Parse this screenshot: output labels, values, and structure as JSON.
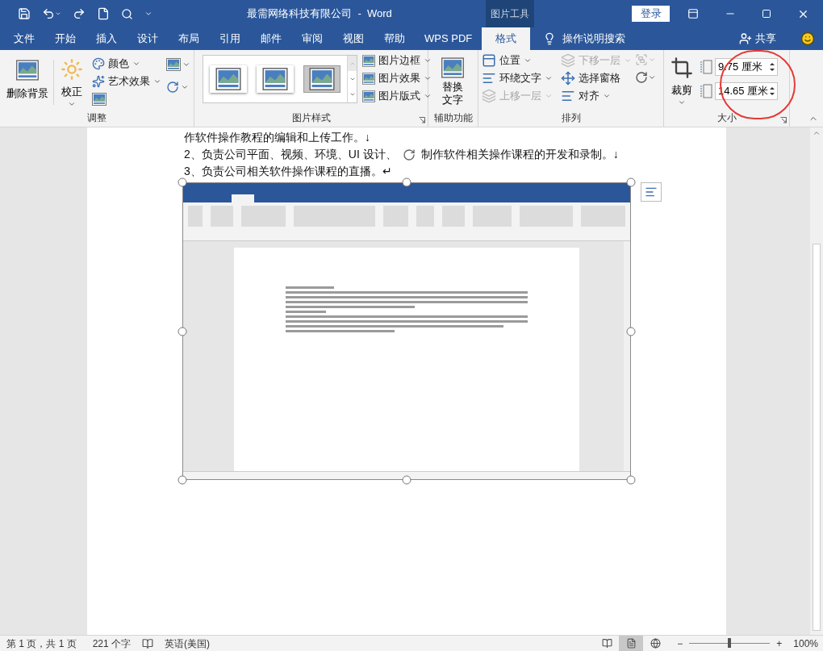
{
  "window": {
    "title": "最需网络科技有限公司  -  Word",
    "context_group": "图片工具",
    "sign_in": "登录"
  },
  "tabs": [
    {
      "label": "文件",
      "selected": false
    },
    {
      "label": "开始",
      "selected": false
    },
    {
      "label": "插入",
      "selected": false
    },
    {
      "label": "设计",
      "selected": false
    },
    {
      "label": "布局",
      "selected": false
    },
    {
      "label": "引用",
      "selected": false
    },
    {
      "label": "邮件",
      "selected": false
    },
    {
      "label": "审阅",
      "selected": false
    },
    {
      "label": "视图",
      "selected": false
    },
    {
      "label": "帮助",
      "selected": false
    },
    {
      "label": "WPS PDF",
      "selected": false
    },
    {
      "label": "格式",
      "selected": true
    }
  ],
  "tell_me": "操作说明搜索",
  "share": "共享",
  "ribbon": {
    "adjust": {
      "label": "调整",
      "remove_background": "删除背景",
      "corrections": "校正",
      "commands": [
        "颜色",
        "艺术效果"
      ]
    },
    "styles": {
      "label": "图片样式",
      "gallery": [
        {
          "selected": false
        },
        {
          "selected": false
        },
        {
          "selected": true
        }
      ],
      "commands": [
        "图片边框",
        "图片效果",
        "图片版式"
      ]
    },
    "accessibility": {
      "label": "辅助功能",
      "alt_text": "替换文字"
    },
    "arrange": {
      "label": "排列",
      "items": [
        {
          "label": "位置",
          "disabled": false
        },
        {
          "label": "环绕文字",
          "disabled": false
        },
        {
          "label": "上移一层",
          "disabled": true
        },
        {
          "label": "下移一层",
          "disabled": true
        },
        {
          "label": "选择窗格",
          "disabled": false
        },
        {
          "label": "对齐",
          "disabled": false
        }
      ]
    },
    "size": {
      "label": "大小",
      "crop": "裁剪",
      "height": "9.75 厘米",
      "width": "14.65 厘米"
    }
  },
  "document": {
    "paragraphs": [
      {
        "segments": [
          "作软件操作教程的编辑和上传工作。↓"
        ]
      },
      {
        "segments": [
          "2、负责公司平面、视频、环境、UI 设计、",
          "制作软件相关操作课程的开发和录制。↓"
        ]
      },
      {
        "segments": [
          "3、负责公司相关软件操作课程的直播。↵"
        ]
      }
    ]
  },
  "status_bar": {
    "page": "第 1 页，共 1 页",
    "words": "221 个字",
    "language": "英语(美国)",
    "views": [
      {
        "selected": false
      },
      {
        "selected": true
      },
      {
        "selected": false
      }
    ],
    "zoom": {
      "out": "−",
      "in": "+",
      "level": 0.5,
      "reading": "100%"
    }
  }
}
